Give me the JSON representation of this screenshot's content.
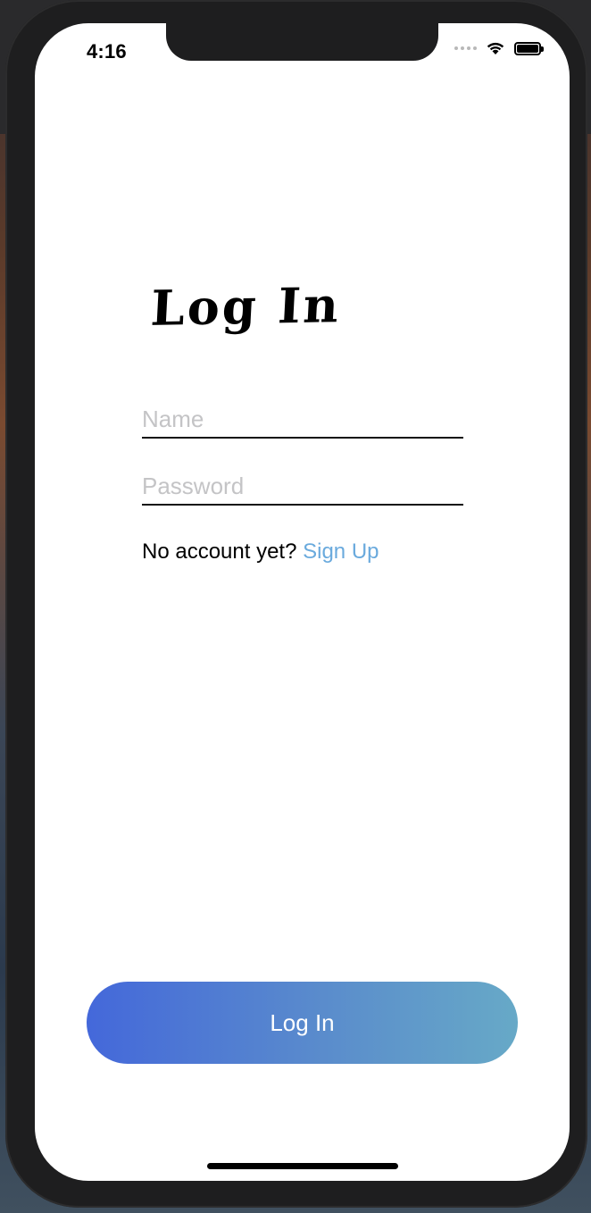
{
  "status_bar": {
    "time": "4:16",
    "wifi_icon": "wifi-icon",
    "battery_icon": "battery-icon",
    "signal_icon": "cellular-signal-icon"
  },
  "screen": {
    "title": "Log In",
    "name_field": {
      "placeholder": "Name",
      "value": ""
    },
    "password_field": {
      "placeholder": "Password",
      "value": ""
    },
    "signup_prompt": "No account yet?",
    "signup_link": "Sign Up",
    "login_button": "Log In"
  },
  "colors": {
    "link": "#6aaadd",
    "button_gradient_start": "#4468da",
    "button_gradient_end": "#67a9c7"
  }
}
